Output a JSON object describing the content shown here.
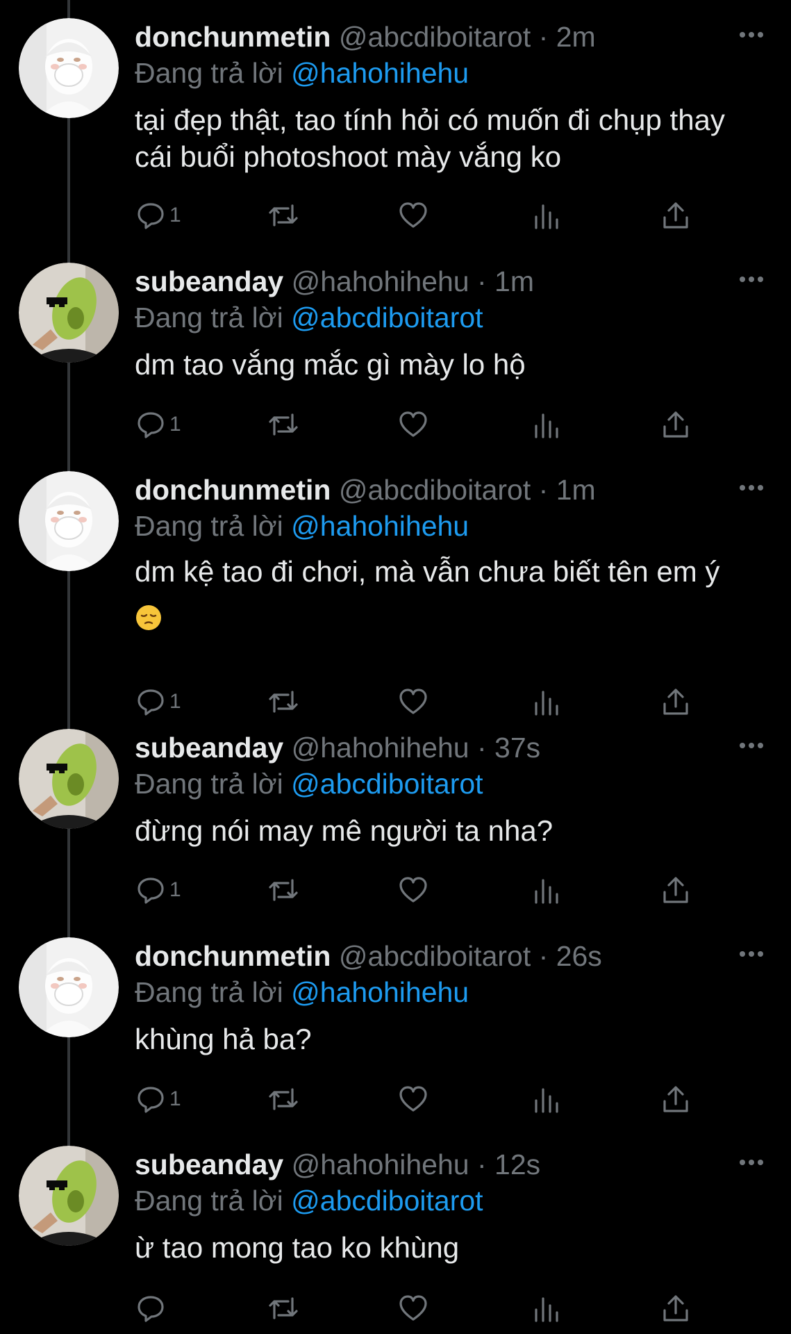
{
  "colors": {
    "background": "#000000",
    "text": "#e7e9ea",
    "muted": "#71767b",
    "accent": "#1d9bf0"
  },
  "icons": {
    "reply": "reply-icon",
    "retweet": "retweet-icon",
    "like": "heart-icon",
    "views": "analytics-icon",
    "share": "share-icon",
    "more": "more-icon"
  },
  "tweets": [
    {
      "name": "donchunmetin",
      "handle": "@abcdiboitarot",
      "dot": "·",
      "time": "2m",
      "reply_prefix": "Đang trả lời",
      "reply_to": "@hahohihehu",
      "text": "tại đẹp thật, tao tính hỏi có muốn đi chụp thay cái buổi photoshoot mày vắng ko",
      "reply_count": "1"
    },
    {
      "name": "subeanday",
      "handle": "@hahohihehu",
      "dot": "·",
      "time": "1m",
      "reply_prefix": "Đang trả lời",
      "reply_to": "@abcdiboitarot",
      "text": "dm tao vắng mắc gì mày lo hộ",
      "reply_count": "1"
    },
    {
      "name": "donchunmetin",
      "handle": "@abcdiboitarot",
      "dot": "·",
      "time": "1m",
      "reply_prefix": "Đang trả lời",
      "reply_to": "@hahohihehu",
      "text": "dm kệ tao đi chơi, mà vẫn chưa biết tên em ý",
      "emoji": "pensive-face",
      "reply_count": "1"
    },
    {
      "name": "subeanday",
      "handle": "@hahohihehu",
      "dot": "·",
      "time": "37s",
      "reply_prefix": "Đang trả lời",
      "reply_to": "@abcdiboitarot",
      "text": "đừng nói may mê người ta nha?",
      "reply_count": "1"
    },
    {
      "name": "donchunmetin",
      "handle": "@abcdiboitarot",
      "dot": "·",
      "time": "26s",
      "reply_prefix": "Đang trả lời",
      "reply_to": "@hahohihehu",
      "text": "khùng hả ba?",
      "reply_count": "1"
    },
    {
      "name": "subeanday",
      "handle": "@hahohihehu",
      "dot": "·",
      "time": "12s",
      "reply_prefix": "Đang trả lời",
      "reply_to": "@abcdiboitarot",
      "text": "ừ tao mong tao ko khùng",
      "reply_count": ""
    }
  ]
}
